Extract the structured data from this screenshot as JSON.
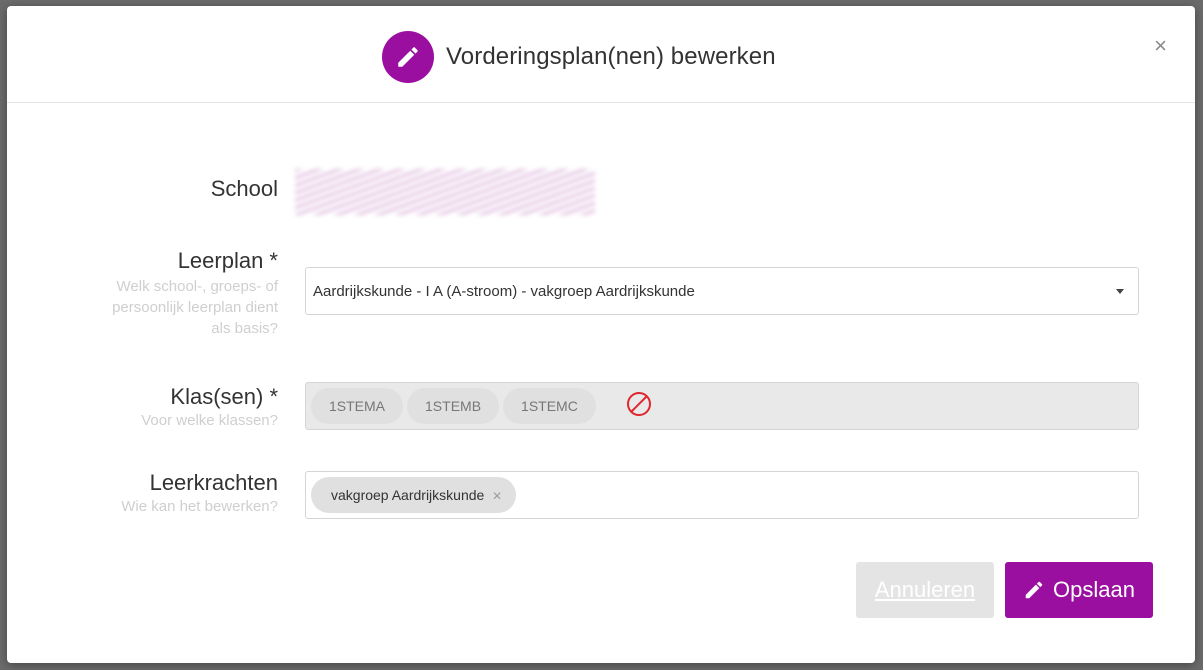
{
  "modal": {
    "title": "Vorderingsplan(nen) bewerken",
    "close_glyph": "×",
    "title_icon": "pencil-icon",
    "accent_color": "#9a0f9f"
  },
  "form": {
    "school": {
      "label": "School"
    },
    "leerplan": {
      "label": "Leerplan *",
      "help_lines": [
        "Welk school-, groeps- of",
        "persoonlijk leerplan dient",
        "als basis?"
      ],
      "selected": "Aardrijkskunde - I A (A-stroom) - vakgroep Aardrijkskunde"
    },
    "klassen": {
      "label": "Klas(sen) *",
      "help": "Voor welke klassen?",
      "tags": [
        "1STEMA",
        "1STEMB",
        "1STEMC"
      ],
      "disabled_icon": "not-allowed-icon"
    },
    "leerkrachten": {
      "label": "Leerkrachten",
      "help": "Wie kan het bewerken?",
      "tags": [
        "vakgroep Aardrijkskunde"
      ],
      "remove_glyph": "×"
    }
  },
  "buttons": {
    "cancel": "Annuleren",
    "save": "Opslaan",
    "save_icon": "pencil-icon"
  }
}
